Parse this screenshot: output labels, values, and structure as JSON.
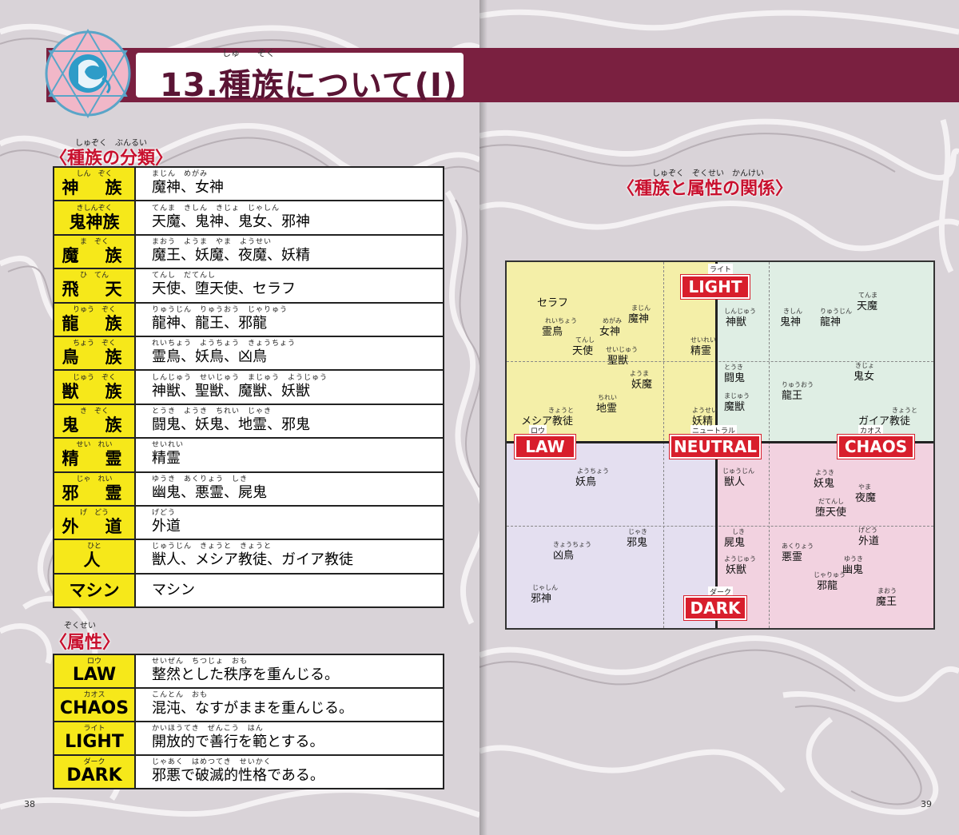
{
  "header": {
    "title": "13.種族について(I)",
    "title_ruby": [
      "しゅ",
      "ぞく"
    ]
  },
  "race_section": {
    "heading": "〈種族の分類〉",
    "ruby": "しゅぞく　ぶんるい",
    "rows": [
      {
        "race": "神　族",
        "race_ruby": "しん　ぞく",
        "members": "魔神、女神",
        "members_ruby": "まじん　めがみ"
      },
      {
        "race": "鬼神族",
        "race_ruby": "きしんぞく",
        "members": "天魔、鬼神、鬼女、邪神",
        "members_ruby": "てんま　きしん　きじょ　じゃしん"
      },
      {
        "race": "魔　族",
        "race_ruby": "ま　ぞく",
        "members": "魔王、妖魔、夜魔、妖精",
        "members_ruby": "まおう　ようま　やま　ようせい"
      },
      {
        "race": "飛　天",
        "race_ruby": "ひ　てん",
        "members": "天使、堕天使、セラフ",
        "members_ruby": "てんし　だてんし"
      },
      {
        "race": "龍　族",
        "race_ruby": "りゅう　ぞく",
        "members": "龍神、龍王、邪龍",
        "members_ruby": "りゅうじん　りゅうおう　じゃりゅう"
      },
      {
        "race": "鳥　族",
        "race_ruby": "ちょう　ぞく",
        "members": "霊鳥、妖鳥、凶鳥",
        "members_ruby": "れいちょう　ようちょう　きょうちょう"
      },
      {
        "race": "獣　族",
        "race_ruby": "じゅう　ぞく",
        "members": "神獣、聖獣、魔獣、妖獣",
        "members_ruby": "しんじゅう　せいじゅう　まじゅう　ようじゅう"
      },
      {
        "race": "鬼　族",
        "race_ruby": "き　ぞく",
        "members": "闘鬼、妖鬼、地霊、邪鬼",
        "members_ruby": "とうき　ようき　ちれい　じゃき"
      },
      {
        "race": "精　霊",
        "race_ruby": "せい　れい",
        "members": "精霊",
        "members_ruby": "せいれい"
      },
      {
        "race": "邪　霊",
        "race_ruby": "じゃ　れい",
        "members": "幽鬼、悪霊、屍鬼",
        "members_ruby": "ゆうき　あくりょう　しき"
      },
      {
        "race": "外　道",
        "race_ruby": "げ　どう",
        "members": "外道",
        "members_ruby": "げどう"
      },
      {
        "race": "人",
        "race_ruby": "ひと",
        "members": "獣人、メシア教徒、ガイア教徒",
        "members_ruby": "じゅうじん　きょうと　きょうと"
      },
      {
        "race": "マシン",
        "race_ruby": "",
        "members": "マシン",
        "members_ruby": ""
      }
    ]
  },
  "attr_section": {
    "heading": "〈属性〉",
    "ruby": "ぞくせい",
    "rows": [
      {
        "attr": "LAW",
        "attr_ruby": "ロウ",
        "desc": "整然とした秩序を重んじる。",
        "desc_ruby": "せいぜん　ちつじょ　おも"
      },
      {
        "attr": "CHAOS",
        "attr_ruby": "カオス",
        "desc": "混沌、なすがままを重んじる。",
        "desc_ruby": "こんとん　おも"
      },
      {
        "attr": "LIGHT",
        "attr_ruby": "ライト",
        "desc": "開放的で善行を範とする。",
        "desc_ruby": "かいほうてき　ぜんこう　はん"
      },
      {
        "attr": "DARK",
        "attr_ruby": "ダーク",
        "desc": "邪悪で破滅的性格である。",
        "desc_ruby": "じゃあく　はめつてき　せいかく"
      }
    ]
  },
  "relation_section": {
    "heading": "〈種族と属性の関係〉",
    "ruby": "しゅぞく　ぞくせい　かんけい",
    "axes": {
      "light": {
        "label": "LIGHT",
        "ruby": "ライト"
      },
      "dark": {
        "label": "DARK",
        "ruby": "ダーク"
      },
      "law": {
        "label": "LAW",
        "ruby": "ロウ"
      },
      "neutral": {
        "label": "NEUTRAL",
        "ruby": "ニュートラル"
      },
      "chaos": {
        "label": "CHAOS",
        "ruby": "カオス"
      }
    },
    "colors": {
      "light_law": "#f4efa8",
      "light_chaos": "#dfeee4",
      "dark_law": "#e4dff0",
      "dark_chaos": "#f2d2e0",
      "neutral": "#ffffff",
      "axis_red": "#d81e2c"
    },
    "entries": [
      {
        "name": "セラフ",
        "ruby": ""
      },
      {
        "name": "霊鳥",
        "ruby": "れいちょう"
      },
      {
        "name": "女神",
        "ruby": "めがみ"
      },
      {
        "name": "魔神",
        "ruby": "まじん"
      },
      {
        "name": "天使",
        "ruby": "てんし"
      },
      {
        "name": "聖獣",
        "ruby": "せいじゅう"
      },
      {
        "name": "妖魔",
        "ruby": "ようま"
      },
      {
        "name": "地霊",
        "ruby": "ちれい"
      },
      {
        "name": "メシア教徒",
        "ruby": "きょうと"
      },
      {
        "name": "神獣",
        "ruby": "しんじゅう"
      },
      {
        "name": "精霊",
        "ruby": "せいれい"
      },
      {
        "name": "闘鬼",
        "ruby": "とうき"
      },
      {
        "name": "魔獣",
        "ruby": "まじゅう"
      },
      {
        "name": "妖精",
        "ruby": "ようせい"
      },
      {
        "name": "鬼神",
        "ruby": "きしん"
      },
      {
        "name": "龍神",
        "ruby": "りゅうじん"
      },
      {
        "name": "天魔",
        "ruby": "てんま"
      },
      {
        "name": "鬼女",
        "ruby": "きじょ"
      },
      {
        "name": "龍王",
        "ruby": "りゅうおう"
      },
      {
        "name": "ガイア教徒",
        "ruby": "きょうと"
      },
      {
        "name": "妖鳥",
        "ruby": "ようちょう"
      },
      {
        "name": "凶鳥",
        "ruby": "きょうちょう"
      },
      {
        "name": "邪鬼",
        "ruby": "じゃき"
      },
      {
        "name": "邪神",
        "ruby": "じゃしん"
      },
      {
        "name": "獣人",
        "ruby": "じゅうじん"
      },
      {
        "name": "屍鬼",
        "ruby": "しき"
      },
      {
        "name": "妖獣",
        "ruby": "ようじゅう"
      },
      {
        "name": "妖鬼",
        "ruby": "ようき"
      },
      {
        "name": "夜魔",
        "ruby": "やま"
      },
      {
        "name": "堕天使",
        "ruby": "だてんし"
      },
      {
        "name": "外道",
        "ruby": "げどう"
      },
      {
        "name": "悪霊",
        "ruby": "あくりょう"
      },
      {
        "name": "幽鬼",
        "ruby": "ゆうき"
      },
      {
        "name": "邪龍",
        "ruby": "じゃりゅう"
      },
      {
        "name": "魔王",
        "ruby": "まおう"
      }
    ]
  },
  "page_numbers": {
    "left": "38",
    "right": "39"
  }
}
